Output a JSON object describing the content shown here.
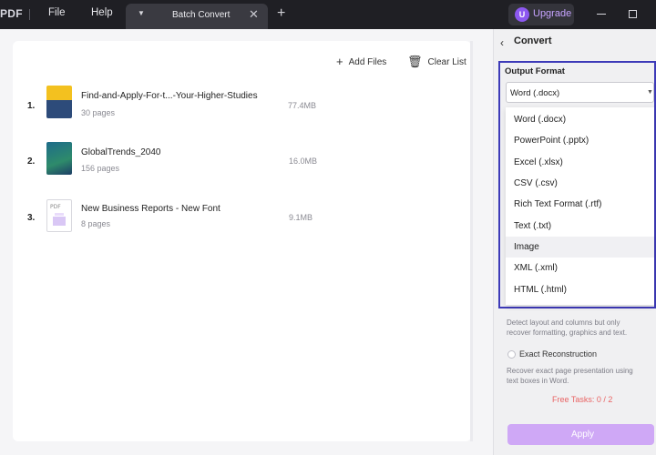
{
  "titlebar": {
    "logo": "PDF",
    "menu": [
      "File",
      "Help"
    ],
    "tab_label": "Batch Convert",
    "upgrade_avatar": "U",
    "upgrade_label": "Upgrade"
  },
  "toolbar": {
    "add_files": "Add Files",
    "clear_list": "Clear List"
  },
  "files": [
    {
      "num": "1.",
      "name": "Find-and-Apply-For-t...-Your-Higher-Studies",
      "pages": "30 pages",
      "size": "77.4MB"
    },
    {
      "num": "2.",
      "name": "GlobalTrends_2040",
      "pages": "156 pages",
      "size": "16.0MB"
    },
    {
      "num": "3.",
      "name": "New Business Reports - New Font",
      "pages": "8 pages",
      "size": "9.1MB"
    }
  ],
  "panel": {
    "title": "Convert",
    "output_label": "Output Format",
    "selected": "Word (.docx)",
    "options": [
      "Word (.docx)",
      "PowerPoint (.pptx)",
      "Excel (.xlsx)",
      "CSV (.csv)",
      "Rich Text Format (.rtf)",
      "Text (.txt)",
      "Image",
      "XML (.xml)",
      "HTML (.html)"
    ],
    "hovered_option": "Image",
    "desc1": "Detect layout and columns but only recover formatting, graphics and text.",
    "radio_label": "Exact Reconstruction",
    "desc2": "Recover exact page presentation using text boxes in Word.",
    "free_tasks": "Free Tasks: 0 / 2",
    "apply": "Apply"
  },
  "colors": {
    "accent": "#8c58f0",
    "highlight_border": "#3d3ab8",
    "apply_bg": "#cfa8f6",
    "free_tasks": "#e96464"
  }
}
